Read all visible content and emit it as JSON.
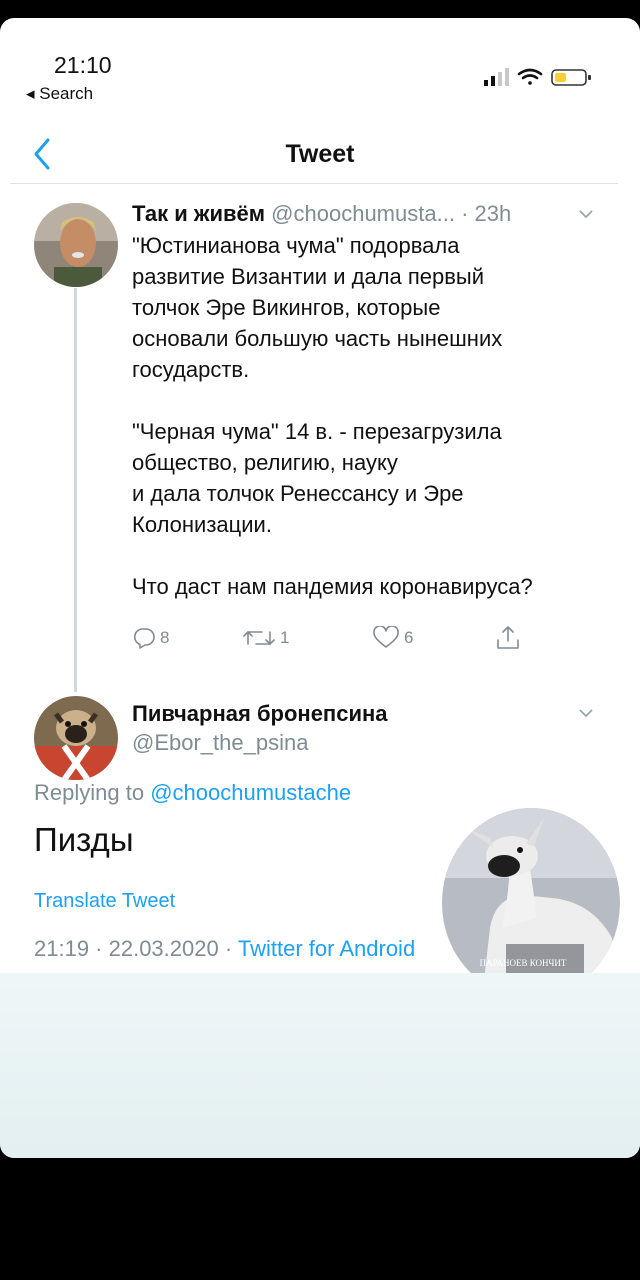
{
  "status_bar": {
    "time": "21:10",
    "back_label": "◂ Search"
  },
  "nav": {
    "title": "Tweet"
  },
  "tweet1": {
    "name": "Так и живём",
    "handle": "@choochumusta...",
    "age": "· 23h",
    "paragraphs": [
      [
        "\"Юстинианова чума\" подорвала",
        "развитие Византии и дала первый",
        "толчок Эре Викингов, которые",
        "основали большую часть нынешних",
        "государств."
      ],
      [
        "\"Черная чума\" 14 в. - перезагрузила",
        "общество, религию, науку",
        "и дала толчок Ренессансу и Эре",
        "Колонизации."
      ],
      [
        "Что даст нам пандемия коронавируса?"
      ]
    ],
    "actions": {
      "replies": "8",
      "retweets": "1",
      "likes": "6"
    }
  },
  "tweet2": {
    "name": "Пивчарная бронепсина",
    "handle": "@Ebor_the_psina",
    "replying_prefix": "Replying to",
    "replying_handle": "@choochumustache",
    "text": "Пизды",
    "translate_label": "Translate Tweet",
    "timestamp": "21:19 · 22.03.2020 · ",
    "source": "Twitter for Android"
  },
  "watermark": {
    "caption": "ПАРАНОЕВ КОНЧИТ"
  },
  "colors": {
    "link": "#1da1f2",
    "muted": "#7f8c94",
    "background": "#000000"
  }
}
